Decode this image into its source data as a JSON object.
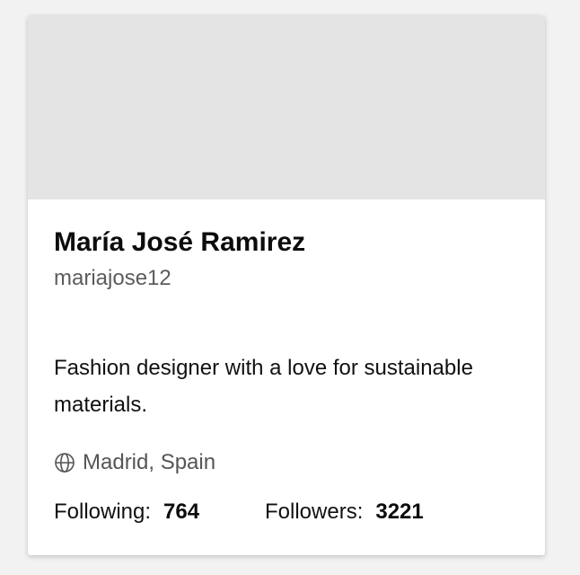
{
  "profile": {
    "name": "María José Ramirez",
    "username": "mariajose12",
    "bio": "Fashion designer with a love for sustainable materials.",
    "location": "Madrid, Spain",
    "location_icon": "globe-icon",
    "stats": {
      "following_label": "Following:",
      "following_value": "764",
      "followers_label": "Followers:",
      "followers_value": "3221"
    }
  },
  "colors": {
    "banner": "#e4e4e4",
    "card": "#ffffff",
    "page_background": "#f2f2f2",
    "muted_text": "#5c5c5c"
  }
}
